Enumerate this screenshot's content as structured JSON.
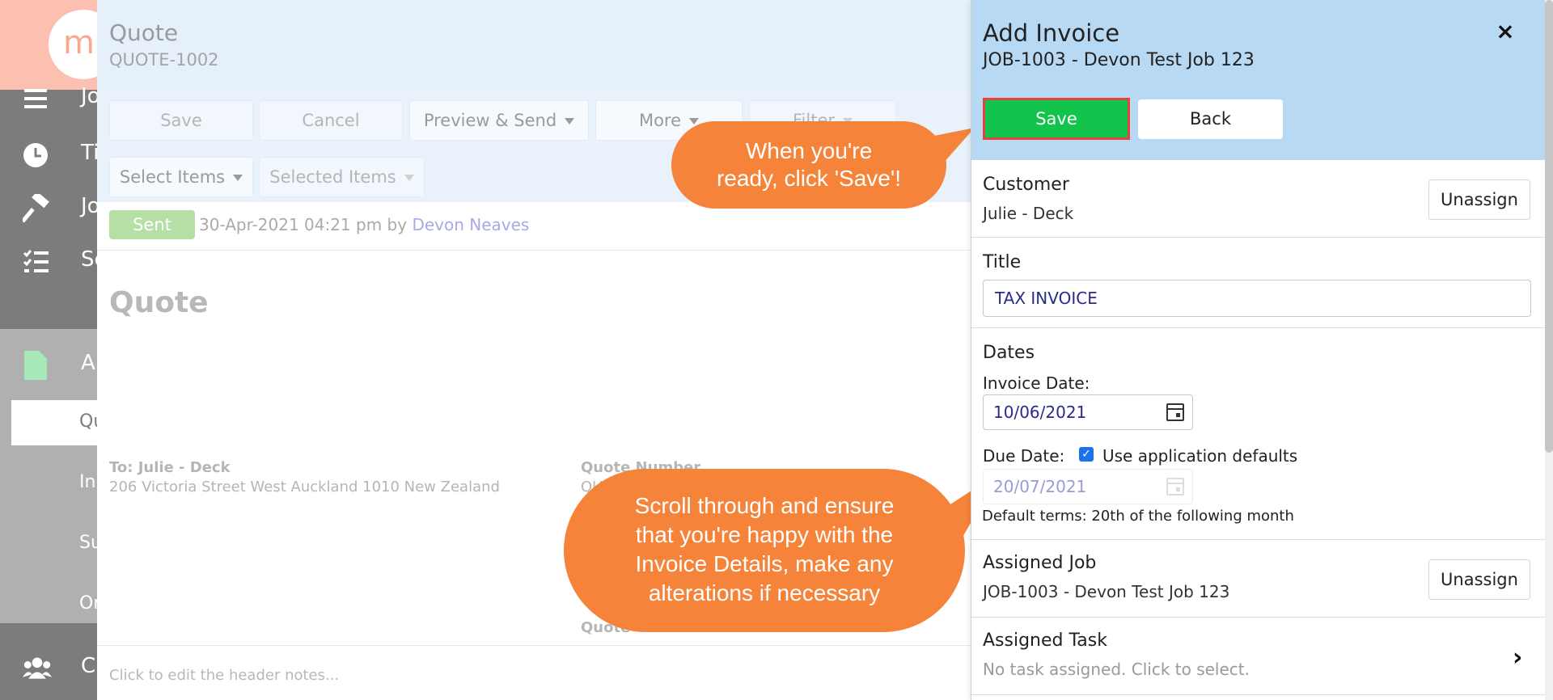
{
  "nav": {
    "logo_text": "m",
    "items": [
      {
        "label": "Jo"
      },
      {
        "label": "Ti"
      },
      {
        "label": "Jo"
      },
      {
        "label": "Sc"
      },
      {
        "label": "A"
      }
    ],
    "sub_items": [
      {
        "label": "Qu"
      },
      {
        "label": "In"
      },
      {
        "label": "Su"
      },
      {
        "label": "Or"
      }
    ],
    "bottom_item": {
      "label": "C"
    }
  },
  "main": {
    "title": "Quote",
    "subtitle": "QUOTE-1002",
    "toolbar": {
      "save": "Save",
      "cancel": "Cancel",
      "preview_send": "Preview & Send",
      "more": "More",
      "filter": "Filter",
      "select_items": "Select Items",
      "selected_items": "Selected Items"
    },
    "status": {
      "badge": "Sent",
      "text": "30-Apr-2021 04:21 pm by",
      "user": "Devon Neaves"
    },
    "doc": {
      "title": "Quote",
      "to_name": "To: Julie - Deck",
      "to_address": "206 Victoria Street West Auckland 1010 New Zealand",
      "quote_number_label": "Quote Number",
      "quote_number_value": "QUOTE-1002",
      "quote_fragment": "Quote"
    },
    "notes_placeholder": "Click to edit the header notes..."
  },
  "panel": {
    "title": "Add Invoice",
    "subtitle": "JOB-1003 - Devon Test Job 123",
    "close": "×",
    "save": "Save",
    "back": "Back",
    "customer": {
      "label": "Customer",
      "value": "Julie - Deck",
      "action": "Unassign"
    },
    "title_field": {
      "label": "Title",
      "value": "TAX INVOICE"
    },
    "dates": {
      "label": "Dates",
      "invoice_date_label": "Invoice Date:",
      "invoice_date": "10/06/2021",
      "due_date_label": "Due Date:",
      "use_defaults_label": "Use application defaults",
      "use_defaults_checked": true,
      "due_date": "20/07/2021",
      "default_terms": "Default terms: 20th of the following month"
    },
    "assigned_job": {
      "label": "Assigned Job",
      "value": "JOB-1003 - Devon Test Job 123",
      "action": "Unassign"
    },
    "assigned_task": {
      "label": "Assigned Task",
      "value": "No task assigned. Click to select."
    }
  },
  "callouts": {
    "save_hint": [
      "When you're",
      "ready, click 'Save'!"
    ],
    "scroll_hint": [
      "Scroll through and ensure",
      "that you're happy with the",
      "Invoice Details, make any",
      "alterations if necessary"
    ]
  },
  "colors": {
    "save_green": "#12c44b",
    "highlight_red": "#e84040",
    "callout_orange": "#f5843a",
    "panel_header": "#b8d9f3"
  }
}
